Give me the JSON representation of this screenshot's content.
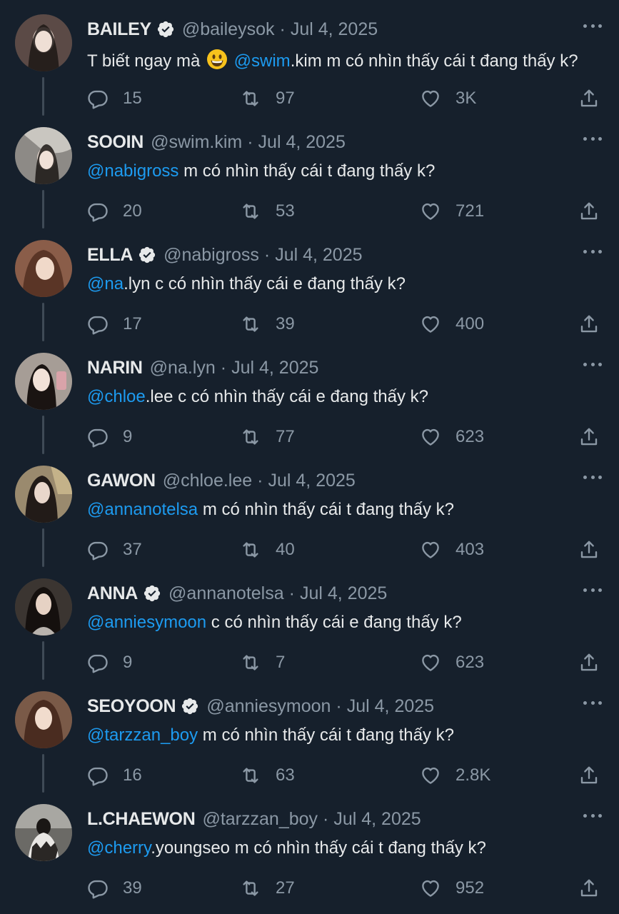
{
  "tweets": [
    {
      "name": "BAILEY",
      "verified": true,
      "handle": "@baileysok",
      "date": "Jul 4, 2025",
      "text_before": "T biết ngay mà",
      "emoji": "grinning-face",
      "mention": "@swim",
      "text_after": ".kim m có nhìn thấy cái t đang thấy k?",
      "replies": "15",
      "retweets": "97",
      "likes": "3K",
      "avatar_color": "#5b4a46"
    },
    {
      "name": "SOOIN",
      "verified": false,
      "handle": "@swim.kim",
      "date": "Jul 4, 2025",
      "text_before": "",
      "emoji": "",
      "mention": "@nabigross",
      "text_after": " m có nhìn thấy cái t đang thấy k?",
      "replies": "20",
      "retweets": "53",
      "likes": "721",
      "avatar_color": "#8d8a86"
    },
    {
      "name": "ELLA",
      "verified": true,
      "handle": "@nabigross",
      "date": "Jul 4, 2025",
      "text_before": "",
      "emoji": "",
      "mention": "@na",
      "text_after": ".lyn c có nhìn thấy cái e đang thấy k?",
      "replies": "17",
      "retweets": "39",
      "likes": "400",
      "avatar_color": "#8a5d49"
    },
    {
      "name": "NARIN",
      "verified": false,
      "handle": "@na.lyn",
      "date": "Jul 4, 2025",
      "text_before": "",
      "emoji": "",
      "mention": "@chloe",
      "text_after": ".lee c có nhìn thấy cái e đang thấy k?",
      "replies": "9",
      "retweets": "77",
      "likes": "623",
      "avatar_color": "#a69d96"
    },
    {
      "name": "GAWON",
      "verified": false,
      "handle": "@chloe.lee",
      "date": "Jul 4, 2025",
      "text_before": "",
      "emoji": "",
      "mention": "@annanotelsa",
      "text_after": " m có nhìn thấy cái t đang thấy k?",
      "replies": "37",
      "retweets": "40",
      "likes": "403",
      "avatar_color": "#9a8a6e"
    },
    {
      "name": "ANNA",
      "verified": true,
      "handle": "@annanotelsa",
      "date": "Jul 4, 2025",
      "text_before": "",
      "emoji": "",
      "mention": "@anniesymoon",
      "text_after": " c có nhìn thấy cái e đang thấy k?",
      "replies": "9",
      "retweets": "7",
      "likes": "623",
      "avatar_color": "#3b3531"
    },
    {
      "name": "SEOYOON",
      "verified": true,
      "handle": "@anniesymoon",
      "date": "Jul 4, 2025",
      "text_before": "",
      "emoji": "",
      "mention": "@tarzzan_boy",
      "text_after": " m có nhìn thấy cái t đang thấy k?",
      "replies": "16",
      "retweets": "63",
      "likes": "2.8K",
      "avatar_color": "#7a5a48"
    },
    {
      "name": "L.CHAEWON",
      "verified": false,
      "handle": "@tarzzan_boy",
      "date": "Jul 4, 2025",
      "text_before": "",
      "emoji": "",
      "mention": "@cherry",
      "text_after": ".youngseo m có nhìn thấy cái t đang thấy k?",
      "replies": "39",
      "retweets": "27",
      "likes": "952",
      "avatar_color": "#6b6a66"
    }
  ],
  "colors": {
    "background": "#16202c",
    "mention": "#1d9bf0",
    "muted": "#8b98a5",
    "text": "#e7e9ea",
    "verified": "#e7e9ea"
  },
  "icons": [
    "reply-icon",
    "retweet-icon",
    "like-icon",
    "share-icon",
    "more-icon",
    "verified-badge-icon",
    "grinning-face-emoji"
  ],
  "separator": "·"
}
